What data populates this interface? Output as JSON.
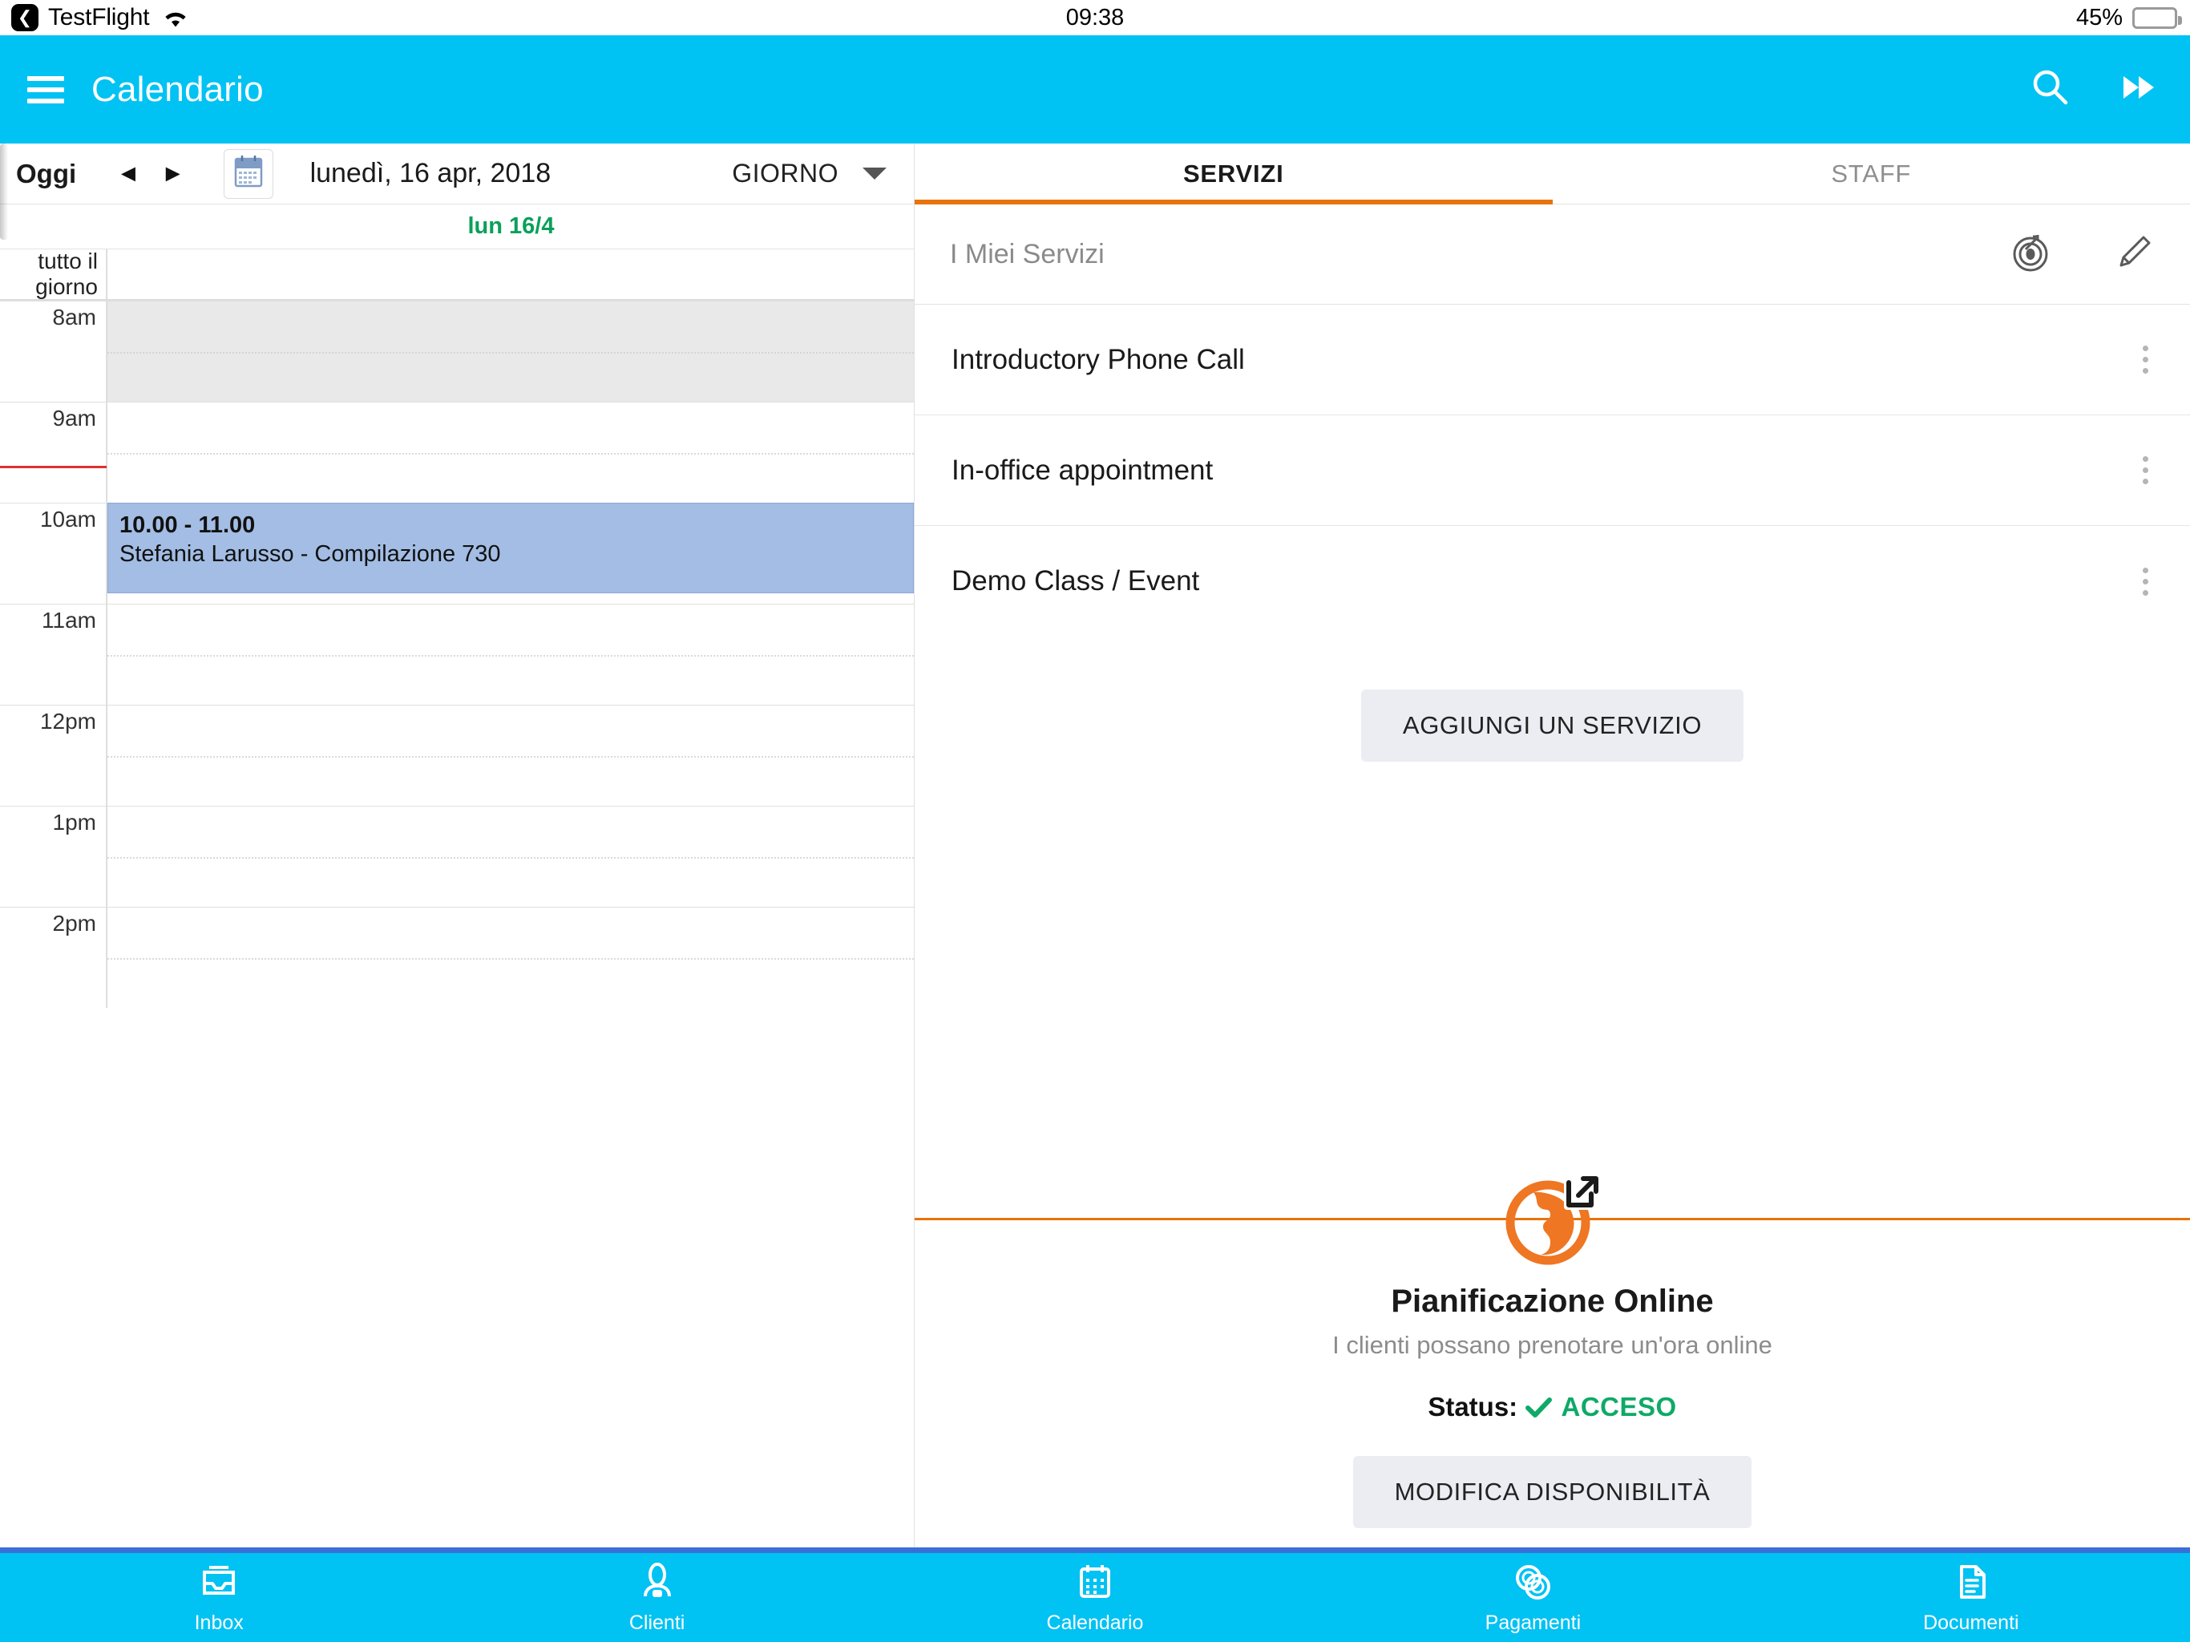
{
  "statusbar": {
    "back_icon": "back-chevron-icon",
    "app_name": "TestFlight",
    "wifi_icon": "wifi-icon",
    "time": "09:38",
    "battery_percent": "45%",
    "battery_icon": "battery-icon",
    "battery_level": 45
  },
  "appbar": {
    "menu_icon": "hamburger-menu-icon",
    "title": "Calendario",
    "search_icon": "search-icon",
    "forward_icon": "fast-forward-icon",
    "bg_color": "#00c2f3"
  },
  "calendar_toolbar": {
    "today_label": "Oggi",
    "prev_icon": "previous-arrow-icon",
    "next_icon": "next-arrow-icon",
    "datepicker_icon": "calendar-icon",
    "date_label": "lunedì, 16 apr, 2018",
    "view_label": "GIORNO",
    "view_caret_icon": "chevron-down-icon"
  },
  "calendar": {
    "day_header": "lun 16/4",
    "allday_label": "tutto il giorno",
    "hours": [
      {
        "label": "8am",
        "shaded": true
      },
      {
        "label": "9am",
        "shaded": false
      },
      {
        "label": "10am",
        "shaded": false
      },
      {
        "label": "11am",
        "shaded": false
      },
      {
        "label": "12pm",
        "shaded": false
      },
      {
        "label": "1pm",
        "shaded": false
      },
      {
        "label": "2pm",
        "shaded": false
      }
    ],
    "now_time": "09:38",
    "events": [
      {
        "time": "10.00 - 11.00",
        "title": "Stefania Larusso - Compilazione 730",
        "start_hour_index": 2,
        "duration_hours": 0.9,
        "color": "#a3bde4"
      }
    ]
  },
  "services_panel": {
    "tabs": [
      {
        "label": "SERVIZI",
        "active": true
      },
      {
        "label": "STAFF",
        "active": false
      }
    ],
    "header": {
      "title": "I Miei Servizi",
      "target_icon": "target-icon",
      "edit_icon": "pencil-icon"
    },
    "items": [
      {
        "label": "Introductory Phone Call",
        "menu_icon": "kebab-menu-icon"
      },
      {
        "label": "In-office appointment",
        "menu_icon": "kebab-menu-icon"
      },
      {
        "label": "Demo Class / Event",
        "menu_icon": "kebab-menu-icon"
      }
    ],
    "add_service_label": "AGGIUNGI UN SERVIZIO"
  },
  "online_scheduling": {
    "globe_icon": "globe-external-link-icon",
    "title": "Pianificazione Online",
    "subtitle": "I clienti possano prenotare un'ora online",
    "status_label": "Status:",
    "status_check_icon": "check-icon",
    "status_value": "ACCESO",
    "status_color": "#0fa968",
    "edit_availability_label": "MODIFICA DISPONIBILITÀ",
    "accent_color": "#e8730a"
  },
  "tabbar": {
    "items": [
      {
        "label": "Inbox",
        "icon": "inbox-icon"
      },
      {
        "label": "Clienti",
        "icon": "clients-icon"
      },
      {
        "label": "Calendario",
        "icon": "calendar-icon"
      },
      {
        "label": "Pagamenti",
        "icon": "payments-icon"
      },
      {
        "label": "Documenti",
        "icon": "documents-icon"
      }
    ]
  }
}
